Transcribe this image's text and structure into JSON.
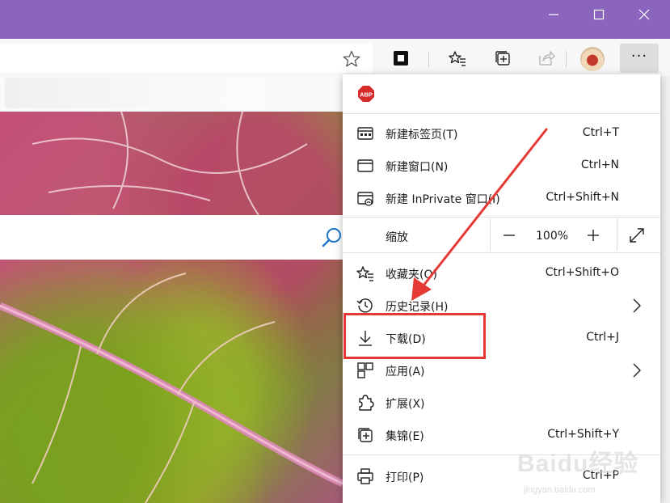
{
  "menu": {
    "new_tab": {
      "label": "新建标签页(T)",
      "shortcut": "Ctrl+T"
    },
    "new_window": {
      "label": "新建窗口(N)",
      "shortcut": "Ctrl+N"
    },
    "new_inprivate": {
      "label": "新建 InPrivate 窗口(I)",
      "shortcut": "Ctrl+Shift+N"
    },
    "zoom": {
      "label": "缩放",
      "value": "100%"
    },
    "favorites": {
      "label": "收藏夹(O)",
      "shortcut": "Ctrl+Shift+O"
    },
    "history": {
      "label": "历史记录(H)"
    },
    "downloads": {
      "label": "下载(D)",
      "shortcut": "Ctrl+J"
    },
    "apps": {
      "label": "应用(A)"
    },
    "extensions": {
      "label": "扩展(X)"
    },
    "collections": {
      "label": "集锦(E)",
      "shortcut": "Ctrl+Shift+Y"
    },
    "print": {
      "label": "打印(P)",
      "shortcut": "Ctrl+P"
    }
  },
  "toolbar": {
    "more_label": "···"
  },
  "watermark": {
    "main": "Baidu经验",
    "sub": "jingyan.baidu.com"
  },
  "colors": {
    "titlebar": "#8b65bd",
    "highlight": "#e53935",
    "abp": "#d72c2c"
  }
}
